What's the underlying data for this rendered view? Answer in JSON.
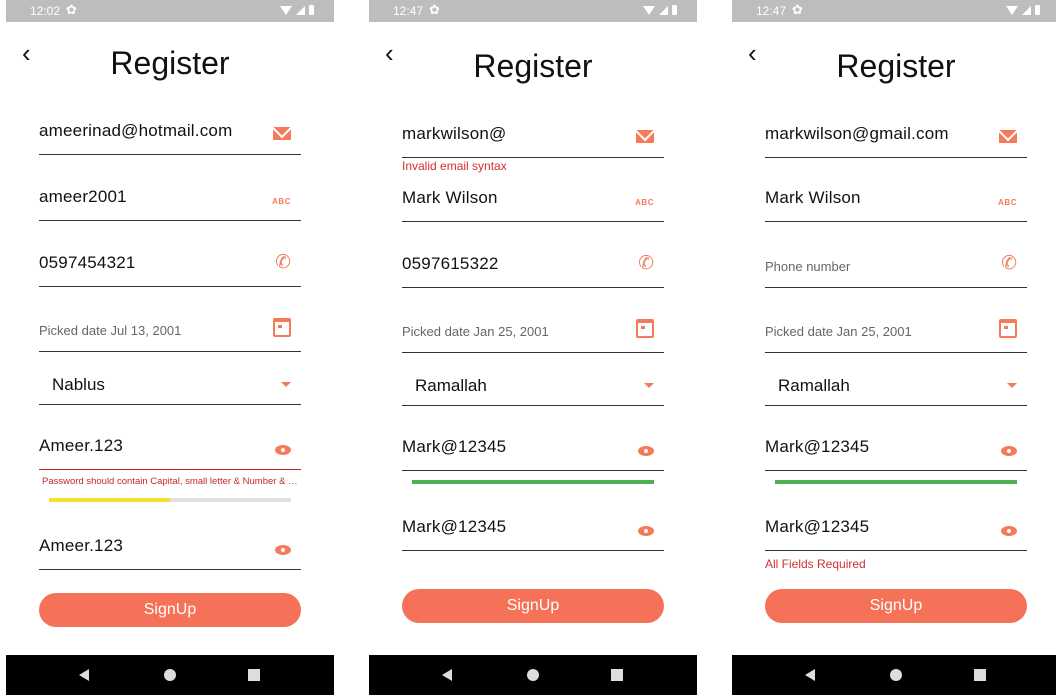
{
  "colors": {
    "accent": "#f57158",
    "error": "#d32f2f",
    "meter_weak": "#f5e12a",
    "meter_strong": "#4caf50"
  },
  "screens": [
    {
      "status": {
        "time": "12:02"
      },
      "title": "Register",
      "email": {
        "value": "ameerinad@hotmail.com",
        "icon": "mail-icon"
      },
      "username": {
        "value": "ameer2001",
        "icon": "abc-icon"
      },
      "phone": {
        "value": "0597454321",
        "icon": "phone-icon"
      },
      "date": {
        "value": "Picked date Jul 13, 2001",
        "icon": "calendar-icon"
      },
      "city": {
        "value": "Nablus"
      },
      "password": {
        "value": "Ameer.123",
        "error": "Password should contain Capital, small letter & Number & Special",
        "strength": 0.5
      },
      "confirm": {
        "value": "Ameer.123"
      },
      "button": "SignUp"
    },
    {
      "status": {
        "time": "12:47"
      },
      "title": "Register",
      "email": {
        "value": "markwilson@",
        "error": "Invalid email syntax"
      },
      "username": {
        "value": "Mark Wilson"
      },
      "phone": {
        "value": "0597615322"
      },
      "date": {
        "value": "Picked date Jan 25, 2001"
      },
      "city": {
        "value": "Ramallah"
      },
      "password": {
        "value": "Mark@12345",
        "strength": 1.0
      },
      "confirm": {
        "value": "Mark@12345"
      },
      "button": "SignUp"
    },
    {
      "status": {
        "time": "12:47"
      },
      "title": "Register",
      "email": {
        "value": "markwilson@gmail.com"
      },
      "username": {
        "value": "Mark Wilson"
      },
      "phone": {
        "placeholder": "Phone number"
      },
      "date": {
        "value": "Picked date Jan 25, 2001"
      },
      "city": {
        "value": "Ramallah"
      },
      "password": {
        "value": "Mark@12345",
        "strength": 1.0
      },
      "confirm": {
        "value": "Mark@12345",
        "error": "All Fields Required"
      },
      "button": "SignUp"
    }
  ]
}
